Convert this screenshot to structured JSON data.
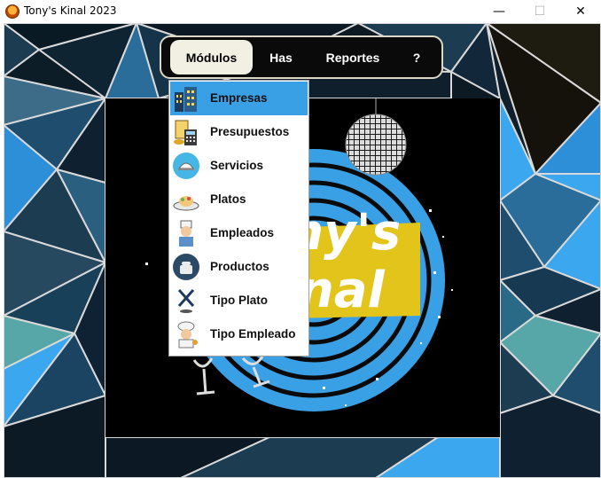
{
  "window": {
    "title": "Tony's Kinal 2023",
    "controls": {
      "minimize": "—",
      "maximize": "☐",
      "close": "✕"
    }
  },
  "navbar": {
    "items": [
      {
        "label": "Módulos",
        "active": true
      },
      {
        "label": "Has",
        "active": false
      },
      {
        "label": "Reportes",
        "active": false
      },
      {
        "label": "?",
        "active": false
      }
    ]
  },
  "menu": {
    "items": [
      {
        "label": "Empresas",
        "icon": "buildings-icon",
        "highlighted": true
      },
      {
        "label": "Presupuestos",
        "icon": "budget-calculator-icon",
        "highlighted": false
      },
      {
        "label": "Servicios",
        "icon": "service-cloche-icon",
        "highlighted": false
      },
      {
        "label": "Platos",
        "icon": "food-plate-icon",
        "highlighted": false
      },
      {
        "label": "Empleados",
        "icon": "chef-employee-icon",
        "highlighted": false
      },
      {
        "label": "Productos",
        "icon": "product-pot-icon",
        "highlighted": false
      },
      {
        "label": "Tipo Plato",
        "icon": "fork-knife-icon",
        "highlighted": false
      },
      {
        "label": "Tipo Empleado",
        "icon": "chef-type-icon",
        "highlighted": false
      }
    ]
  },
  "logo": {
    "text_line1": "Tony's",
    "text_line2": "Kinal"
  },
  "colors": {
    "accent": "#3aa0e6",
    "dark_bg": "#0d1a24",
    "logo_yellow": "#e2c41a"
  }
}
